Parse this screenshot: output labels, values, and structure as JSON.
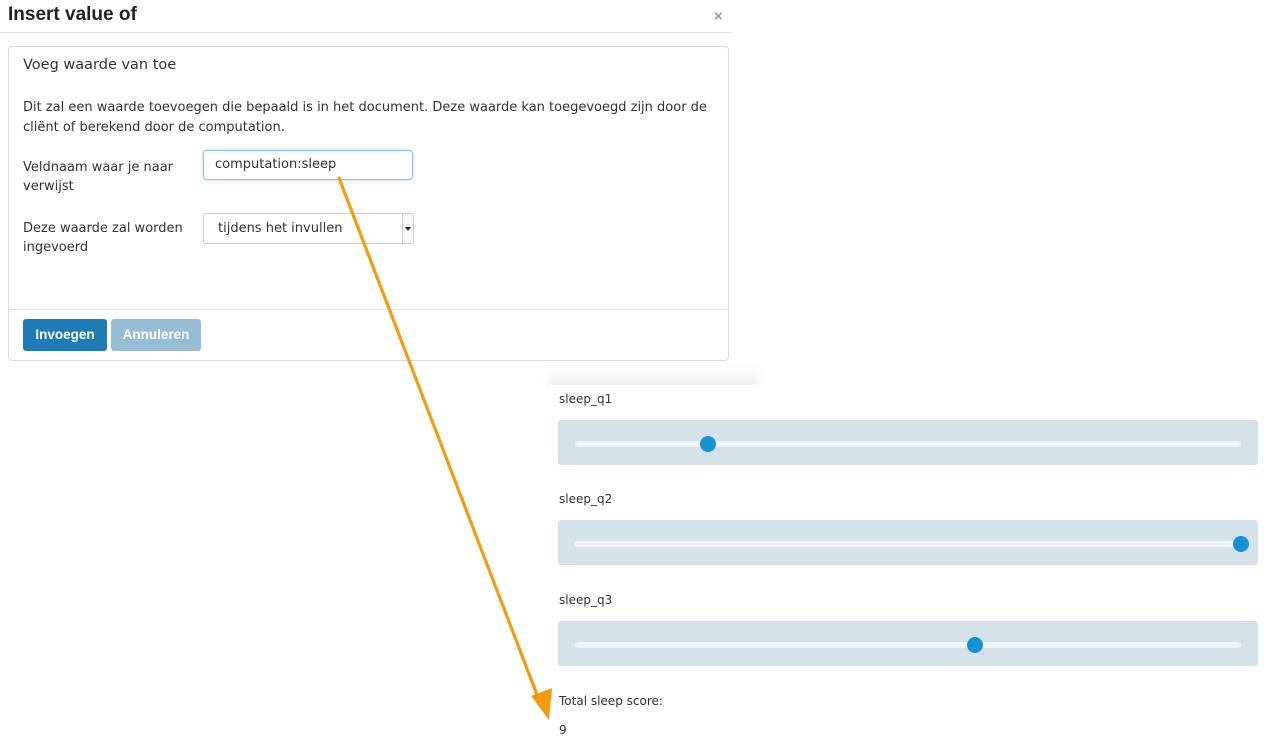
{
  "dialog": {
    "title": "Insert value of",
    "close_glyph": "×",
    "panel_heading": "Voeg waarde van toe",
    "description": "Dit zal een waarde toevoegen die bepaald is in het document. Deze waarde kan toegevoegd zijn door de cliënt of berekend door de computation.",
    "field_name_label": "Veldnaam waar je naar verwijst",
    "field_name_value": "computation:sleep",
    "timing_label": "Deze waarde zal worden ingevoerd",
    "timing_selected": "tijdens het invullen",
    "insert_button": "Invoegen",
    "cancel_button": "Annuleren",
    "colors": {
      "primary_button": "#1f7bb6",
      "disabled_button": "#97bdd5"
    }
  },
  "survey": {
    "sliders": [
      {
        "label": "sleep_q1",
        "fraction": 0.2
      },
      {
        "label": "sleep_q2",
        "fraction": 1.0
      },
      {
        "label": "sleep_q3",
        "fraction": 0.6
      }
    ],
    "score_label": "Total sleep score:",
    "score_value": "9",
    "colors": {
      "track_background": "#d5e2ea",
      "thumb": "#1592d4"
    }
  },
  "annotation": {
    "arrow_color": "#f39c12"
  }
}
